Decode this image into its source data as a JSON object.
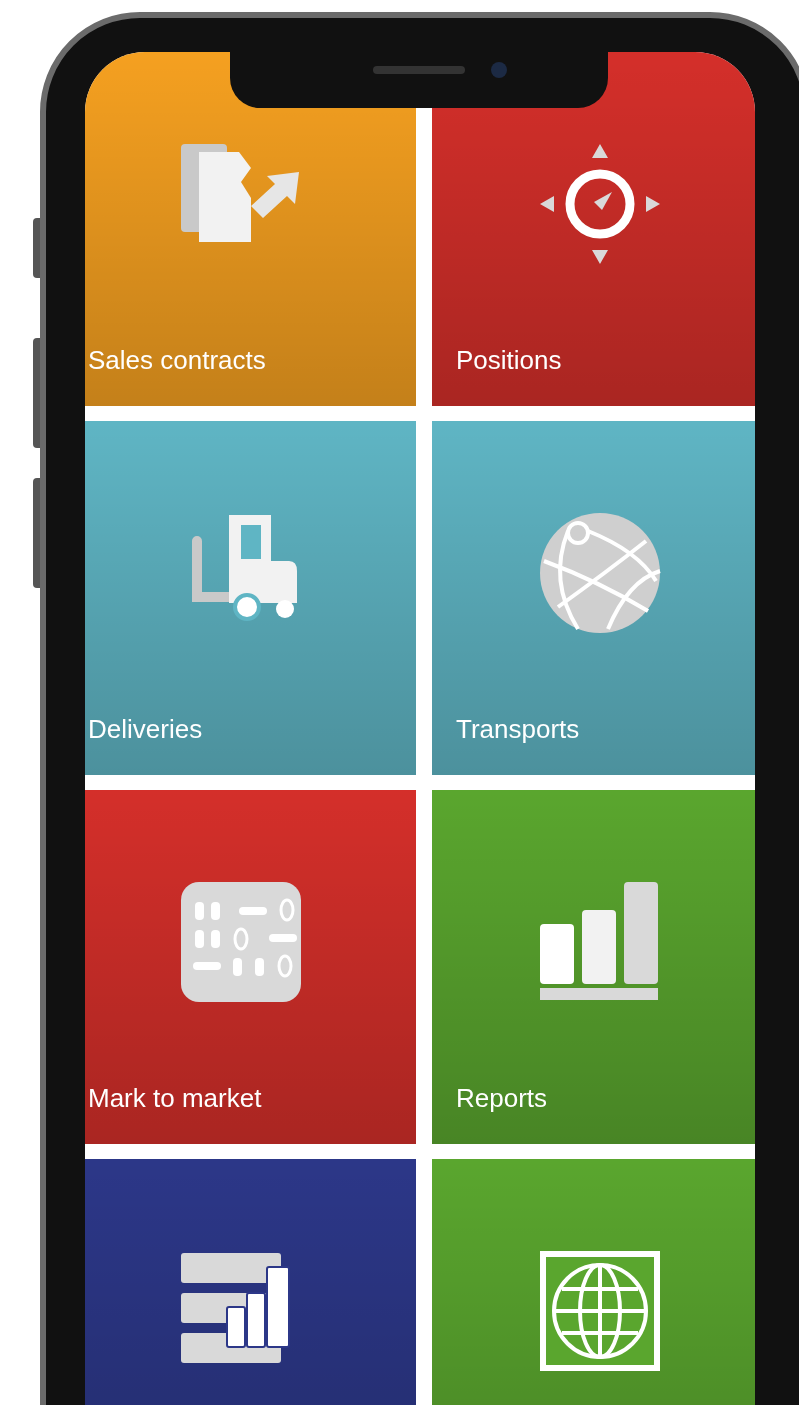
{
  "tiles": [
    {
      "label": "Sales contracts",
      "color": "#f5a020"
    },
    {
      "label": "Positions",
      "color": "#d42f2a"
    },
    {
      "label": "Deliveries",
      "color": "#5fb5c4"
    },
    {
      "label": "Transports",
      "color": "#5fb5c4"
    },
    {
      "label": "Mark to market",
      "color": "#d42f2a"
    },
    {
      "label": "Reports",
      "color": "#5aa62e"
    },
    {
      "color": "#2c3788"
    },
    {
      "color": "#5aa62e"
    }
  ]
}
